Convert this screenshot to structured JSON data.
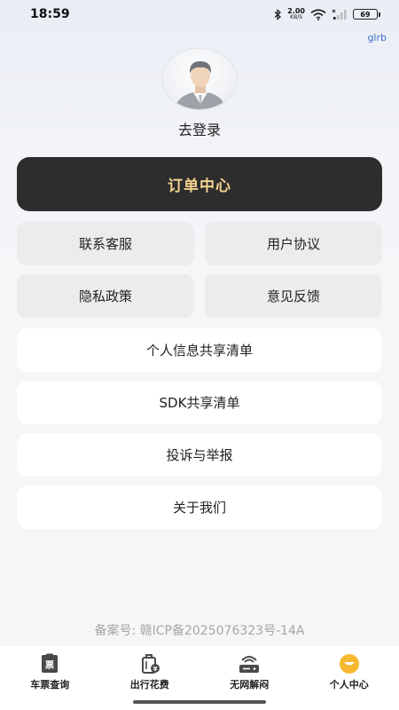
{
  "status_bar": {
    "time": "18:59",
    "net_speed_value": "2.00",
    "net_speed_unit": "KB/S",
    "battery": "69",
    "icons": [
      "bluetooth-icon",
      "wifi-icon",
      "signal-icon",
      "battery-icon"
    ]
  },
  "corner_tag": "glrb",
  "profile": {
    "avatar_icon": "default-user-avatar-icon",
    "login_label": "去登录"
  },
  "order_center": {
    "label": "订单中心"
  },
  "grid": {
    "customer_service": "联系客服",
    "user_agreement": "用户协议",
    "privacy_policy": "隐私政策",
    "feedback": "意见反馈"
  },
  "list": {
    "personal_info_list": "个人信息共享清单",
    "sdk_list": "SDK共享清单",
    "complaint": "投诉与举报",
    "about_us": "关于我们"
  },
  "icp": "备案号: 赣ICP备2025076323号-14A",
  "tabs": [
    {
      "label": "车票查询",
      "icon": "ticket-icon",
      "active": false
    },
    {
      "label": "出行花费",
      "icon": "luggage-cost-icon",
      "active": false
    },
    {
      "label": "无网解闷",
      "icon": "offline-router-icon",
      "active": false
    },
    {
      "label": "个人中心",
      "icon": "profile-smile-icon",
      "active": true
    }
  ],
  "colors": {
    "order_bg": "#2d2d2d",
    "order_text": "#f3d28f",
    "active_tab": "#f5b82e",
    "corner_tag": "#3a6ec7"
  }
}
